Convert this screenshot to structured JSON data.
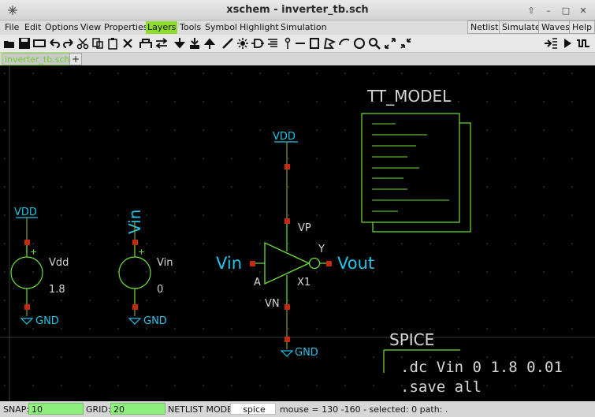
{
  "window": {
    "title": "xschem - inverter_tb.sch"
  },
  "menu": {
    "items": [
      "File",
      "Edit",
      "Options",
      "View",
      "Properties",
      "Layers",
      "Tools",
      "Symbol",
      "Highlight",
      "Simulation"
    ],
    "highlighted": "Layers",
    "right_buttons": [
      "Netlist",
      "Simulate",
      "Waves",
      "Help"
    ]
  },
  "tabs": {
    "active": "inverter_tb.sch",
    "add": "+"
  },
  "schematic": {
    "vdd_source": {
      "supply": "VDD",
      "name": "Vdd",
      "value": "1.8",
      "ground": "GND"
    },
    "vin_source": {
      "net_label": "Vin",
      "name": "Vin",
      "value": "0",
      "ground": "GND"
    },
    "inverter": {
      "supply": "VDD",
      "ground": "GND",
      "pin_vp": "VP",
      "pin_vn": "VN",
      "pin_a": "A",
      "pin_y": "Y",
      "instance": "X1",
      "input_label": "Vin",
      "output_label": "Vout"
    },
    "model_block": {
      "title": "TT_MODEL"
    },
    "spice_block": {
      "title": "SPICE",
      "line1": ".dc Vin 0 1.8 0.01",
      "line2": ".save all"
    }
  },
  "colors": {
    "net": "#7f9c3a",
    "label": "#22c3e8",
    "symbol": "#6fe13a",
    "pin": "#c42b0e",
    "text": "#d6d6d6",
    "highlight": "#8fdc2e"
  },
  "status": {
    "snap_label": "SNAP:",
    "snap": "10",
    "grid_label": "GRID:",
    "grid": "20",
    "netlist_label": "NETLIST MODE:",
    "netlist_mode": "spice",
    "info": "mouse = 130 -160 - selected: 0 path: ."
  }
}
